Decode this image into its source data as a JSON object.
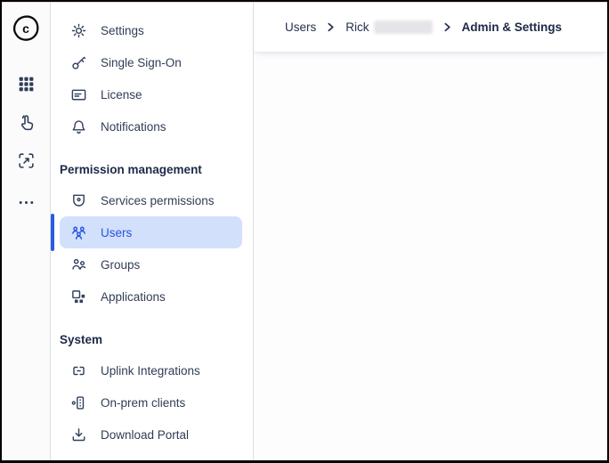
{
  "app": {
    "logo_letter": "c",
    "accent_color": "#2456df",
    "selected_bg_color": "#d2e0fc",
    "selected_bar_color": "#2b5be2",
    "icon_color": "#33415e",
    "text_color": "#303c55"
  },
  "rail": {
    "icons": [
      {
        "name": "cato-logo"
      },
      {
        "name": "apps-grid-icon"
      },
      {
        "name": "touch-pointer-icon"
      },
      {
        "name": "screen-expand-icon"
      },
      {
        "name": "more-dots-icon"
      }
    ]
  },
  "sidebar": {
    "sections": [
      {
        "title": "",
        "items": [
          {
            "label": "Settings",
            "icon": "gear-icon"
          },
          {
            "label": "Single Sign-On",
            "icon": "key-icon"
          },
          {
            "label": "License",
            "icon": "license-card-icon"
          },
          {
            "label": "Notifications",
            "icon": "bell-icon"
          }
        ]
      },
      {
        "title": "Permission management",
        "items": [
          {
            "label": "Services permissions",
            "icon": "shield-dot-icon"
          },
          {
            "label": "Users",
            "icon": "users-three-icon",
            "selected": true
          },
          {
            "label": "Groups",
            "icon": "users-two-icon"
          },
          {
            "label": "Applications",
            "icon": "app-squares-icon"
          }
        ]
      },
      {
        "title": "System",
        "items": [
          {
            "label": "Uplink Integrations",
            "icon": "chain-link-icon"
          },
          {
            "label": "On-prem clients",
            "icon": "client-tower-icon"
          },
          {
            "label": "Download Portal",
            "icon": "download-icon"
          }
        ]
      }
    ],
    "selected_item": "Users"
  },
  "breadcrumb": {
    "level1": "Users",
    "level2": "Rick",
    "level2_redacted": true,
    "current": "Admin & Settings"
  }
}
